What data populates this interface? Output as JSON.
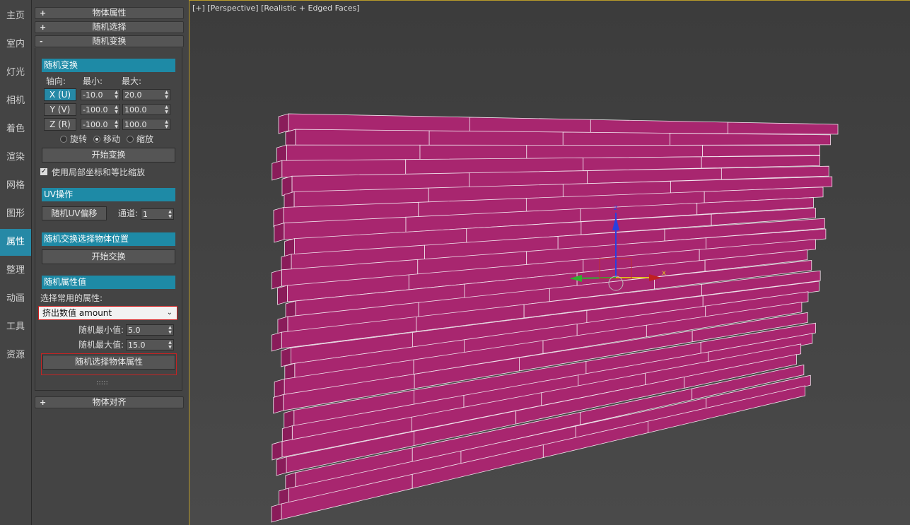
{
  "tabs": [
    "主页",
    "室内",
    "灯光",
    "相机",
    "着色",
    "渲染",
    "网格",
    "图形",
    "属性",
    "整理",
    "动画",
    "工具",
    "资源"
  ],
  "active_tab": "属性",
  "rollouts": {
    "object_props": "物体属性",
    "random_select": "随机选择",
    "random_transform": "随机变换",
    "object_align": "物体对齐"
  },
  "transform": {
    "section_title": "随机变换",
    "axis_label": "轴向:",
    "min_label": "最小:",
    "max_label": "最大:",
    "rows": [
      {
        "axis": "X (U)",
        "min": "-10.0",
        "max": "20.0"
      },
      {
        "axis": "Y (V)",
        "min": "-100.0",
        "max": "100.0"
      },
      {
        "axis": "Z (R)",
        "min": "-100.0",
        "max": "100.0"
      }
    ],
    "mode_rotate": "旋转",
    "mode_move": "移动",
    "mode_scale": "缩放",
    "start_button": "开始变换",
    "local_checkbox": "使用局部坐标和等比缩放"
  },
  "uv": {
    "section_title": "UV操作",
    "offset_button": "随机UV偏移",
    "channel_label": "通道:",
    "channel_value": "1"
  },
  "swap": {
    "section_title": "随机交换选择物体位置",
    "start_button": "开始交换"
  },
  "attr": {
    "section_title": "随机属性值",
    "common_label": "选择常用的属性:",
    "dropdown_value": "挤出数值 amount",
    "min_label": "随机最小值:",
    "min_value": "5.0",
    "max_label": "随机最大值:",
    "max_value": "15.0",
    "select_button": "随机选择物体属性",
    "grip": ":::::"
  },
  "viewport": {
    "label": "[+] [Perspective] [Realistic + Edged Faces]",
    "brick_color": "#a8266f",
    "gizmo_x_label": "x",
    "gizmo_z_label": "z"
  }
}
